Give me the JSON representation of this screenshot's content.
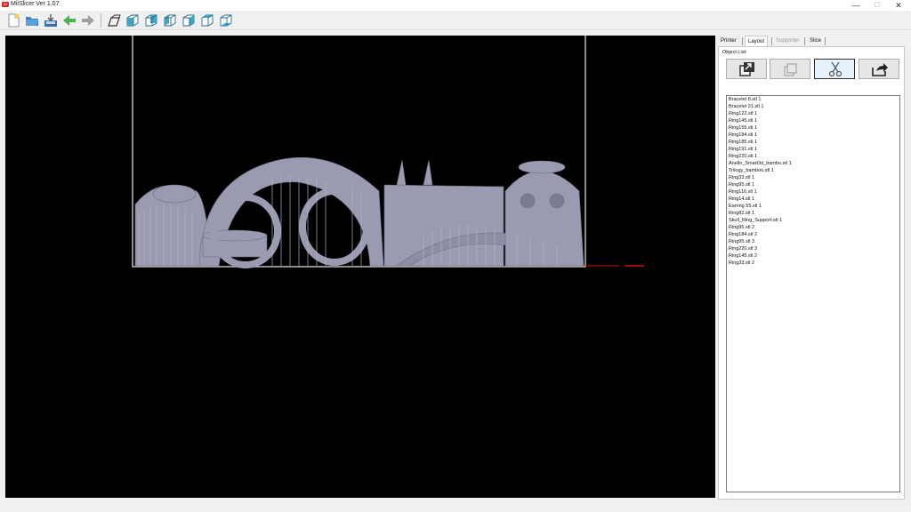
{
  "window": {
    "title": "MiiSlicer Ver 1.07",
    "logo_text": "M",
    "minimize_glyph": "—",
    "maximize_glyph": "▢",
    "close_glyph": "✕"
  },
  "toolbar": {
    "buttons": [
      {
        "name": "new-file-icon",
        "color": "#f4d03f"
      },
      {
        "name": "open-folder-icon",
        "color": "#3b82c4"
      },
      {
        "name": "save-icon",
        "color": "#3a6fb0"
      },
      {
        "name": "undo-arrow-icon",
        "color": "#4caf50"
      },
      {
        "name": "redo-arrow-icon",
        "color": "#9e9e9e"
      },
      {
        "name": "perspective-view-icon",
        "color": "#333333"
      },
      {
        "name": "front-view-cube-icon",
        "color": "#3aa6c9"
      },
      {
        "name": "back-view-cube-icon",
        "color": "#3aa6c9"
      },
      {
        "name": "left-view-cube-icon",
        "color": "#3aa6c9"
      },
      {
        "name": "right-view-cube-icon",
        "color": "#3aa6c9"
      },
      {
        "name": "top-view-cube-icon",
        "color": "#3aa6c9"
      },
      {
        "name": "bottom-view-cube-icon",
        "color": "#3aa6c9"
      }
    ]
  },
  "viewport": {
    "background": "#000000",
    "model_color": "#9a9ab0",
    "build_frame_color": "#e8e8e8",
    "axis_color": "#cc1111"
  },
  "panel": {
    "tabs": [
      {
        "label": "Printer",
        "state": "normal"
      },
      {
        "label": "Layout",
        "state": "active"
      },
      {
        "label": "Supporter",
        "state": "disabled"
      },
      {
        "label": "Slice",
        "state": "normal"
      }
    ],
    "object_list_label": "Object List:",
    "action_buttons": [
      {
        "name": "add-object-icon",
        "selected": false
      },
      {
        "name": "duplicate-object-icon",
        "selected": false
      },
      {
        "name": "cut-scissors-icon",
        "selected": true
      },
      {
        "name": "export-share-icon",
        "selected": false
      }
    ],
    "objects": [
      "Bracelet 8.stl 1",
      "Bracelet 21.stl 1",
      "Ring122.stl 1",
      "Ring145.stl 1",
      "Ring155.stl 1",
      "Ring184.stl 1",
      "Ring185.stl 1",
      "Ring191.stl 1",
      "Ring220.stl 1",
      "Anello_Smart3d_bambo.stl 1",
      "Trilogy_bamboo.stl 1",
      "Ring33.stl 1",
      "Ring95.stl 1",
      "Ring116.stl 1",
      "Ring14.stl 1",
      "Earring 55.stl 1",
      "Ring82.stl 1",
      "Skull_Ring_Support.stl 1",
      "Ring95.stl 2",
      "Ring184.stl 2",
      "Ring95.stl 3",
      "Ring220.stl 3",
      "Ring145.stl 2",
      "Ring33.stl 2"
    ]
  }
}
